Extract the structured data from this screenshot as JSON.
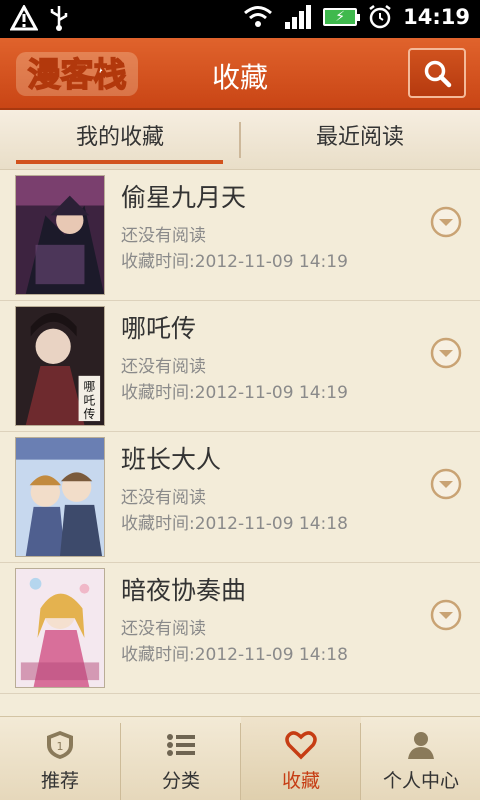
{
  "status_bar": {
    "time": "14:19",
    "icons": [
      "warning-icon",
      "usb-icon",
      "wifi-icon",
      "signal-icon",
      "battery-charging-icon",
      "alarm-icon"
    ]
  },
  "header": {
    "logo_text": "漫客栈",
    "title": "收藏",
    "search_icon": "search-icon"
  },
  "tabs": [
    {
      "label": "我的收藏",
      "active": true
    },
    {
      "label": "最近阅读",
      "active": false
    }
  ],
  "favorites": [
    {
      "title": "偷星九月天",
      "status": "还没有阅读",
      "time": "收藏时间:2012-11-09 14:19"
    },
    {
      "title": "哪吒传",
      "status": "还没有阅读",
      "time": "收藏时间:2012-11-09 14:19",
      "cover_text": "哪吒传"
    },
    {
      "title": "班长大人",
      "status": "还没有阅读",
      "time": "收藏时间:2012-11-09 14:18"
    },
    {
      "title": "暗夜协奏曲",
      "status": "还没有阅读",
      "time": "收藏时间:2012-11-09 14:18"
    }
  ],
  "bottom_nav": [
    {
      "label": "推荐",
      "icon": "shield-badge-icon",
      "badge": "1",
      "active": false
    },
    {
      "label": "分类",
      "icon": "list-icon",
      "active": false
    },
    {
      "label": "收藏",
      "icon": "heart-icon",
      "active": true
    },
    {
      "label": "个人中心",
      "icon": "user-icon",
      "active": false
    }
  ],
  "colors": {
    "accent": "#d2521c",
    "header": "#cf4d1a",
    "background": "#f3ecd9",
    "muted_text": "#8a8a8a"
  }
}
